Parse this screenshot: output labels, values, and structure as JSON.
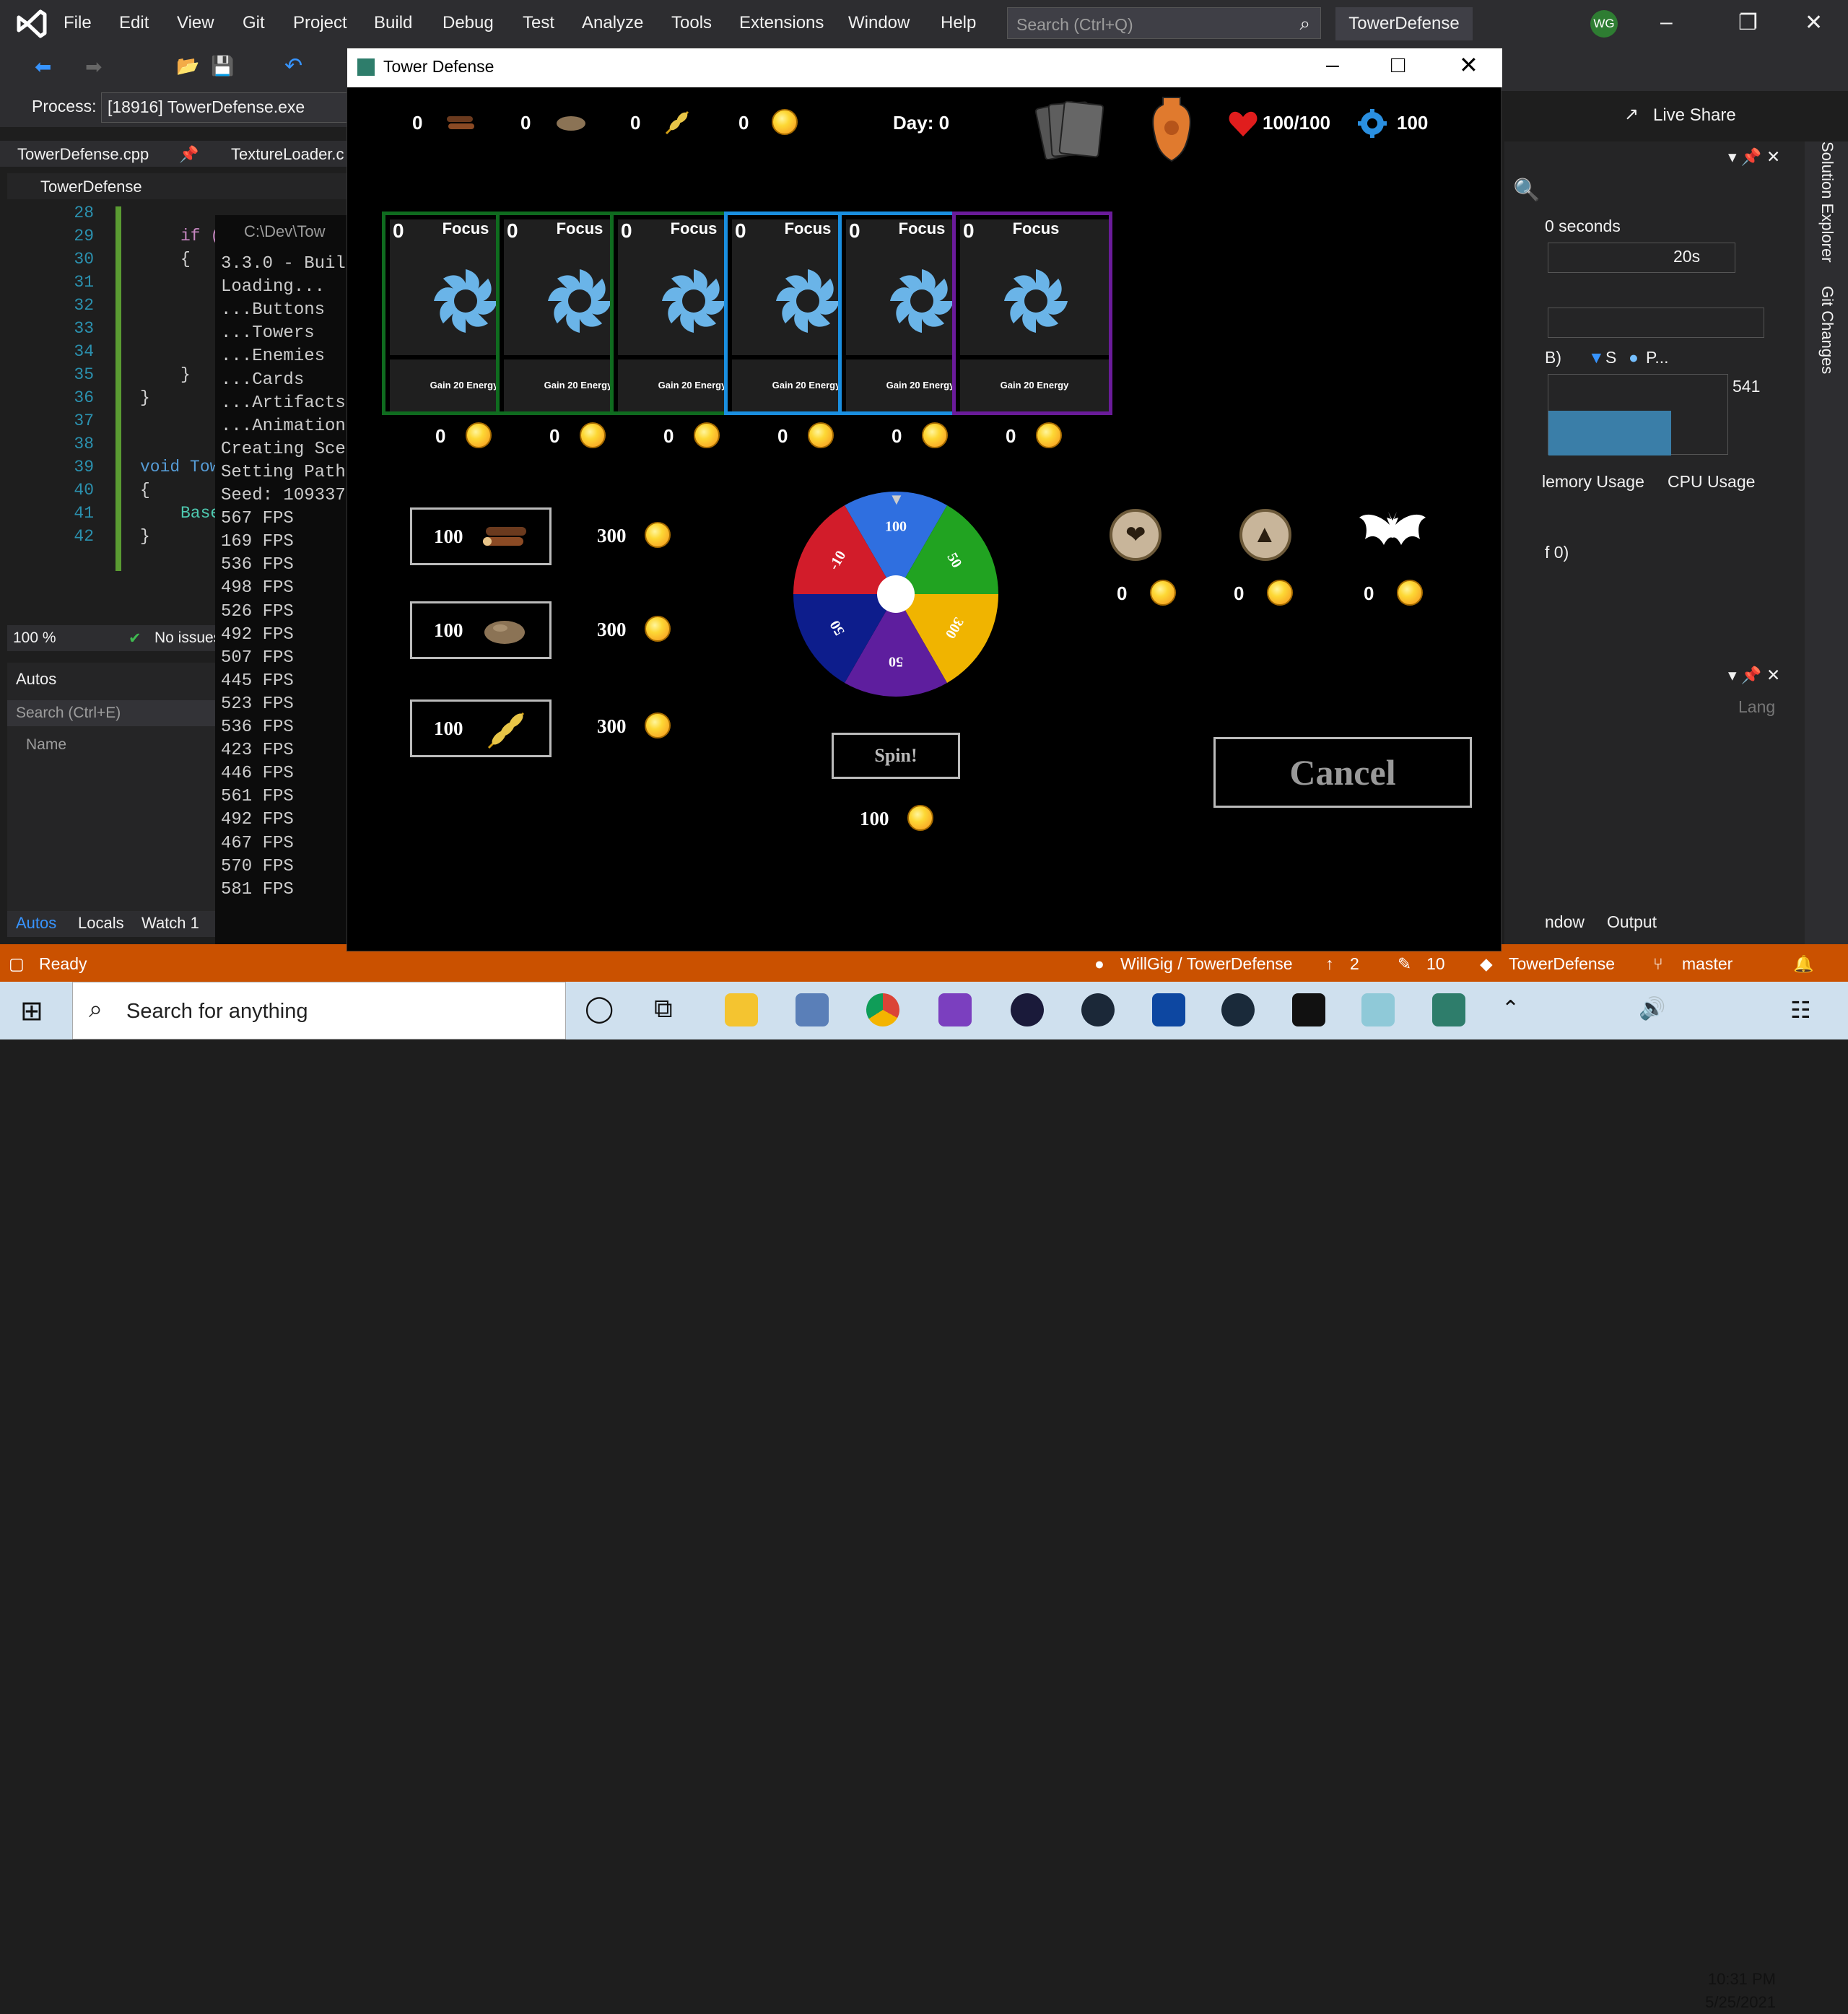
{
  "vs": {
    "menu": [
      "File",
      "Edit",
      "View",
      "Git",
      "Project",
      "Build",
      "Debug",
      "Test",
      "Analyze",
      "Tools",
      "Extensions",
      "Window",
      "Help"
    ],
    "search_placeholder": "Search (Ctrl+Q)",
    "solution_name": "TowerDefense",
    "user_initials": "WG",
    "live_share": "Live Share",
    "process_label": "Process:",
    "process_value": "[18916] TowerDefense.exe",
    "tabs": [
      "TowerDefense.cpp",
      "TextureLoader.c"
    ],
    "file_header": "TowerDefense",
    "line_numbers": [
      "28",
      "29",
      "30",
      "31",
      "32",
      "33",
      "34",
      "35",
      "36",
      "37",
      "38",
      "39",
      "40",
      "41",
      "42"
    ],
    "code_if": "if (",
    "code_brace_open": "{",
    "code_brace_close": "}",
    "code_brace_close2": "}",
    "code_void": "void Tow",
    "code_brace_open2": "{",
    "code_base": "Base",
    "code_brace_close3": "}",
    "zoom": "100 %",
    "no_issues": "No issues",
    "console_title": "C:\\Dev\\Tow",
    "console_lines": [
      "3.3.0 - Buil",
      "Loading...",
      "...Buttons",
      "...Towers",
      "...Enemies",
      "...Cards",
      "...Artifacts",
      "...Animation",
      "Creating Sce",
      "Setting Path",
      "Seed: 109337",
      "567 FPS",
      "169 FPS",
      "536 FPS",
      "498 FPS",
      "526 FPS",
      "492 FPS",
      "507 FPS",
      "445 FPS",
      "523 FPS",
      "536 FPS",
      "423 FPS",
      "446 FPS",
      "561 FPS",
      "492 FPS",
      "467 FPS",
      "570 FPS",
      "581 FPS"
    ],
    "autos_title": "Autos",
    "autos_search": "Search (Ctrl+E)",
    "autos_name_col": "Name",
    "bottom_tabs": [
      "Autos",
      "Locals",
      "Watch 1"
    ],
    "diag": {
      "seconds": "0 seconds",
      "timeline": "20s",
      "legend_b": "B)",
      "legend_s": "S",
      "legend_p": "P...",
      "value": "541",
      "mem_usage": "lemory Usage",
      "cpu_usage": "CPU Usage",
      "count": "f 0)",
      "lang": "Lang",
      "window": "ndow",
      "output": "Output"
    },
    "side_tabs": [
      "Solution Explorer",
      "Git Changes"
    ],
    "status": {
      "ready": "Ready",
      "repo": "WillGig / TowerDefense",
      "up": "2",
      "changes": "10",
      "project": "TowerDefense",
      "branch": "master"
    }
  },
  "taskbar": {
    "search": "Search for anything",
    "time": "10:31 PM",
    "date": "5/25/2021"
  },
  "game": {
    "window_title": "Tower Defense",
    "hud": {
      "wood": "0",
      "stone": "0",
      "wheat": "0",
      "gold": "0",
      "day": "Day: 0",
      "health": "100/100",
      "energy": "100"
    },
    "cards": [
      {
        "cost": "0",
        "name": "Focus",
        "desc": "Gain 20 Energy",
        "price": "0",
        "border": "#0f6b1f"
      },
      {
        "cost": "0",
        "name": "Focus",
        "desc": "Gain 20 Energy",
        "price": "0",
        "border": "#0f6b1f"
      },
      {
        "cost": "0",
        "name": "Focus",
        "desc": "Gain 20 Energy",
        "price": "0",
        "border": "#0f6b1f"
      },
      {
        "cost": "0",
        "name": "Focus",
        "desc": "Gain 20 Energy",
        "price": "0",
        "border": "#1a8fe0"
      },
      {
        "cost": "0",
        "name": "Focus",
        "desc": "Gain 20 Energy",
        "price": "0",
        "border": "#1a8fe0"
      },
      {
        "cost": "0",
        "name": "Focus",
        "desc": "Gain 20 Energy",
        "price": "0",
        "border": "#6a1b9a"
      }
    ],
    "resources": [
      {
        "amount": "100",
        "icon": "wood-icon",
        "price": "300"
      },
      {
        "amount": "100",
        "icon": "stone-icon",
        "price": "300"
      },
      {
        "amount": "100",
        "icon": "wheat-icon",
        "price": "300"
      }
    ],
    "wheel": {
      "segments": [
        {
          "label": "100",
          "color": "#2f6fe0"
        },
        {
          "label": "50",
          "color": "#21a321"
        },
        {
          "label": "300",
          "color": "#f0b400"
        },
        {
          "label": "50",
          "color": "#5e1e9e"
        },
        {
          "label": "50",
          "color": "#0d1d8c"
        },
        {
          "label": "-10",
          "color": "#d21c2a"
        }
      ]
    },
    "spin_label": "Spin!",
    "spin_cost": "100",
    "artifacts": [
      {
        "icon": "artifact-pouch-icon",
        "price": "0"
      },
      {
        "icon": "artifact-beast-icon",
        "price": "0"
      },
      {
        "icon": "bat-icon",
        "price": "0"
      }
    ],
    "cancel_label": "Cancel"
  }
}
